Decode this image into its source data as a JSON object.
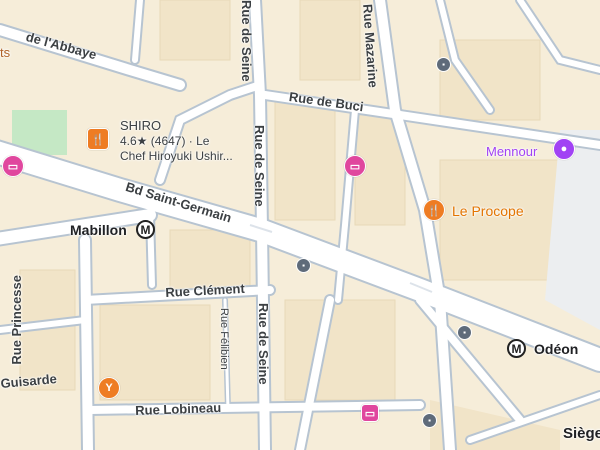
{
  "streets": {
    "abbaye": "de l'Abbaye",
    "seine_top": "Rue de Seine",
    "seine_mid": "Rue de Seine",
    "seine_bottom": "Rue de Seine",
    "mazarine": "Rue Mazarine",
    "buci": "Rue de Buci",
    "saint_germain": "Bd Saint-Germain",
    "clement": "Rue Clément",
    "felibien": "Rue Félibien",
    "princesse": "Rue Princesse",
    "guisarde": "Guisarde",
    "lobineau": "Rue Lobineau"
  },
  "partial_label": "ts",
  "places": {
    "shiro": {
      "name": "SHIRO",
      "rating": "4.6★ (4647) · Le",
      "line3": "Chef Hiroyuki Ushir..."
    },
    "mennour": {
      "name": "Mennour"
    },
    "procope": {
      "name": "Le Procope"
    }
  },
  "stations": {
    "mabillon": "Mabillon",
    "odeon": "Odéon",
    "siege": "Siège"
  },
  "icons": {
    "metro": "M",
    "hotel": "bed-icon",
    "restaurant": "fork-knife-icon",
    "bar": "cocktail-icon",
    "gallery": "palette-icon",
    "bus": "bus-icon"
  },
  "colors": {
    "land": "#f5ecd8",
    "road": "#ffffff",
    "road_outline": "#a9b8c7",
    "hotel": "#e0479e",
    "restaurant": "#ee7c23",
    "gallery": "#a142f4",
    "park": "#c5e8c5"
  }
}
